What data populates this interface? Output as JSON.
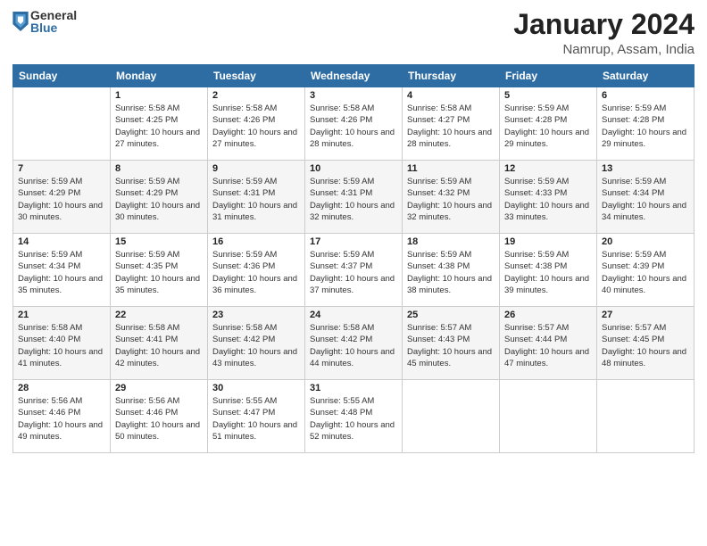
{
  "logo": {
    "general": "General",
    "blue": "Blue"
  },
  "title": "January 2024",
  "location": "Namrup, Assam, India",
  "days_of_week": [
    "Sunday",
    "Monday",
    "Tuesday",
    "Wednesday",
    "Thursday",
    "Friday",
    "Saturday"
  ],
  "weeks": [
    [
      {
        "day": "",
        "sunrise": "",
        "sunset": "",
        "daylight": ""
      },
      {
        "day": "1",
        "sunrise": "Sunrise: 5:58 AM",
        "sunset": "Sunset: 4:25 PM",
        "daylight": "Daylight: 10 hours and 27 minutes."
      },
      {
        "day": "2",
        "sunrise": "Sunrise: 5:58 AM",
        "sunset": "Sunset: 4:26 PM",
        "daylight": "Daylight: 10 hours and 27 minutes."
      },
      {
        "day": "3",
        "sunrise": "Sunrise: 5:58 AM",
        "sunset": "Sunset: 4:26 PM",
        "daylight": "Daylight: 10 hours and 28 minutes."
      },
      {
        "day": "4",
        "sunrise": "Sunrise: 5:58 AM",
        "sunset": "Sunset: 4:27 PM",
        "daylight": "Daylight: 10 hours and 28 minutes."
      },
      {
        "day": "5",
        "sunrise": "Sunrise: 5:59 AM",
        "sunset": "Sunset: 4:28 PM",
        "daylight": "Daylight: 10 hours and 29 minutes."
      },
      {
        "day": "6",
        "sunrise": "Sunrise: 5:59 AM",
        "sunset": "Sunset: 4:28 PM",
        "daylight": "Daylight: 10 hours and 29 minutes."
      }
    ],
    [
      {
        "day": "7",
        "sunrise": "Sunrise: 5:59 AM",
        "sunset": "Sunset: 4:29 PM",
        "daylight": "Daylight: 10 hours and 30 minutes."
      },
      {
        "day": "8",
        "sunrise": "Sunrise: 5:59 AM",
        "sunset": "Sunset: 4:29 PM",
        "daylight": "Daylight: 10 hours and 30 minutes."
      },
      {
        "day": "9",
        "sunrise": "Sunrise: 5:59 AM",
        "sunset": "Sunset: 4:31 PM",
        "daylight": "Daylight: 10 hours and 31 minutes."
      },
      {
        "day": "10",
        "sunrise": "Sunrise: 5:59 AM",
        "sunset": "Sunset: 4:31 PM",
        "daylight": "Daylight: 10 hours and 32 minutes."
      },
      {
        "day": "11",
        "sunrise": "Sunrise: 5:59 AM",
        "sunset": "Sunset: 4:32 PM",
        "daylight": "Daylight: 10 hours and 32 minutes."
      },
      {
        "day": "12",
        "sunrise": "Sunrise: 5:59 AM",
        "sunset": "Sunset: 4:33 PM",
        "daylight": "Daylight: 10 hours and 33 minutes."
      },
      {
        "day": "13",
        "sunrise": "Sunrise: 5:59 AM",
        "sunset": "Sunset: 4:34 PM",
        "daylight": "Daylight: 10 hours and 34 minutes."
      }
    ],
    [
      {
        "day": "14",
        "sunrise": "Sunrise: 5:59 AM",
        "sunset": "Sunset: 4:34 PM",
        "daylight": "Daylight: 10 hours and 35 minutes."
      },
      {
        "day": "15",
        "sunrise": "Sunrise: 5:59 AM",
        "sunset": "Sunset: 4:35 PM",
        "daylight": "Daylight: 10 hours and 35 minutes."
      },
      {
        "day": "16",
        "sunrise": "Sunrise: 5:59 AM",
        "sunset": "Sunset: 4:36 PM",
        "daylight": "Daylight: 10 hours and 36 minutes."
      },
      {
        "day": "17",
        "sunrise": "Sunrise: 5:59 AM",
        "sunset": "Sunset: 4:37 PM",
        "daylight": "Daylight: 10 hours and 37 minutes."
      },
      {
        "day": "18",
        "sunrise": "Sunrise: 5:59 AM",
        "sunset": "Sunset: 4:38 PM",
        "daylight": "Daylight: 10 hours and 38 minutes."
      },
      {
        "day": "19",
        "sunrise": "Sunrise: 5:59 AM",
        "sunset": "Sunset: 4:38 PM",
        "daylight": "Daylight: 10 hours and 39 minutes."
      },
      {
        "day": "20",
        "sunrise": "Sunrise: 5:59 AM",
        "sunset": "Sunset: 4:39 PM",
        "daylight": "Daylight: 10 hours and 40 minutes."
      }
    ],
    [
      {
        "day": "21",
        "sunrise": "Sunrise: 5:58 AM",
        "sunset": "Sunset: 4:40 PM",
        "daylight": "Daylight: 10 hours and 41 minutes."
      },
      {
        "day": "22",
        "sunrise": "Sunrise: 5:58 AM",
        "sunset": "Sunset: 4:41 PM",
        "daylight": "Daylight: 10 hours and 42 minutes."
      },
      {
        "day": "23",
        "sunrise": "Sunrise: 5:58 AM",
        "sunset": "Sunset: 4:42 PM",
        "daylight": "Daylight: 10 hours and 43 minutes."
      },
      {
        "day": "24",
        "sunrise": "Sunrise: 5:58 AM",
        "sunset": "Sunset: 4:42 PM",
        "daylight": "Daylight: 10 hours and 44 minutes."
      },
      {
        "day": "25",
        "sunrise": "Sunrise: 5:57 AM",
        "sunset": "Sunset: 4:43 PM",
        "daylight": "Daylight: 10 hours and 45 minutes."
      },
      {
        "day": "26",
        "sunrise": "Sunrise: 5:57 AM",
        "sunset": "Sunset: 4:44 PM",
        "daylight": "Daylight: 10 hours and 47 minutes."
      },
      {
        "day": "27",
        "sunrise": "Sunrise: 5:57 AM",
        "sunset": "Sunset: 4:45 PM",
        "daylight": "Daylight: 10 hours and 48 minutes."
      }
    ],
    [
      {
        "day": "28",
        "sunrise": "Sunrise: 5:56 AM",
        "sunset": "Sunset: 4:46 PM",
        "daylight": "Daylight: 10 hours and 49 minutes."
      },
      {
        "day": "29",
        "sunrise": "Sunrise: 5:56 AM",
        "sunset": "Sunset: 4:46 PM",
        "daylight": "Daylight: 10 hours and 50 minutes."
      },
      {
        "day": "30",
        "sunrise": "Sunrise: 5:55 AM",
        "sunset": "Sunset: 4:47 PM",
        "daylight": "Daylight: 10 hours and 51 minutes."
      },
      {
        "day": "31",
        "sunrise": "Sunrise: 5:55 AM",
        "sunset": "Sunset: 4:48 PM",
        "daylight": "Daylight: 10 hours and 52 minutes."
      },
      {
        "day": "",
        "sunrise": "",
        "sunset": "",
        "daylight": ""
      },
      {
        "day": "",
        "sunrise": "",
        "sunset": "",
        "daylight": ""
      },
      {
        "day": "",
        "sunrise": "",
        "sunset": "",
        "daylight": ""
      }
    ]
  ]
}
